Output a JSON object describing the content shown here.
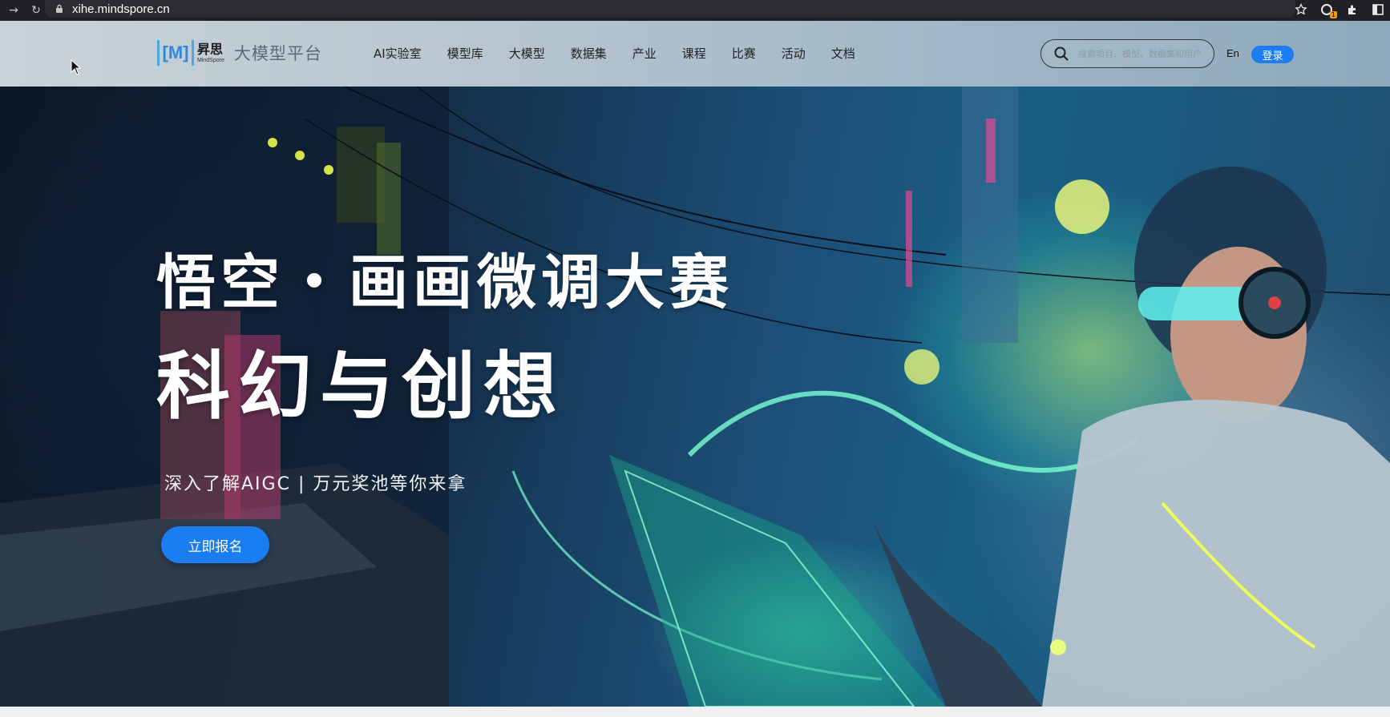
{
  "browser": {
    "url": "xihe.mindspore.cn",
    "extension_badge": "1"
  },
  "header": {
    "logo_mark": "[M]",
    "logo_cn": "昇思",
    "logo_en": "MindSpore",
    "platform_name": "大模型平台",
    "nav": [
      {
        "label": "AI实验室"
      },
      {
        "label": "模型库"
      },
      {
        "label": "大模型"
      },
      {
        "label": "数据集"
      },
      {
        "label": "产业"
      },
      {
        "label": "课程"
      },
      {
        "label": "比赛"
      },
      {
        "label": "活动"
      },
      {
        "label": "文档"
      }
    ],
    "search_placeholder": "搜索项目、模型、数据集和用户",
    "lang_label": "En",
    "login_label": "登录"
  },
  "hero": {
    "title_line1": "悟空・画画微调大赛",
    "title_line2": "科幻与创想",
    "subtitle": "深入了解AIGC | 万元奖池等你来拿",
    "cta_label": "立即报名"
  },
  "colors": {
    "accent": "#1a7df2",
    "browser_bg": "#202124"
  }
}
